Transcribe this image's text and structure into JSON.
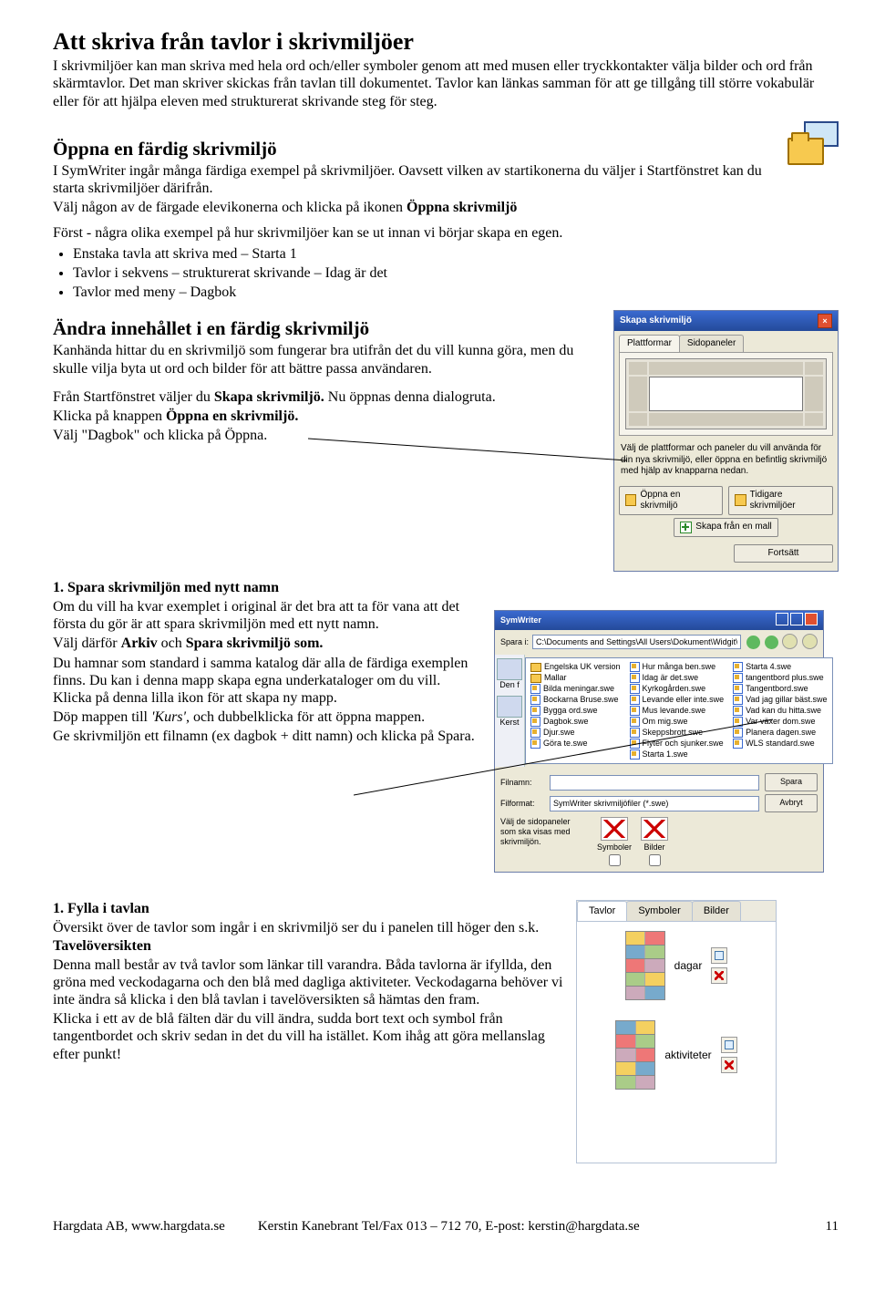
{
  "h1": "Att skriva från tavlor i skrivmiljöer",
  "intro": "I skrivmiljöer kan man skriva med hela ord och/eller symboler genom att med musen eller tryckkontakter välja bilder och ord från skärmtavlor. Det man skriver skickas från tavlan till dokumentet. Tavlor kan länkas samman för att ge tillgång till större vokabulär eller för att hjälpa eleven med strukturerat skrivande steg för steg.",
  "h2_open": "Öppna en färdig skrivmiljö",
  "open_p1": "I SymWriter ingår många färdiga exempel på skrivmiljöer. Oavsett vilken av startikonerna du väljer i Startfönstret kan du starta skrivmiljöer därifrån.",
  "open_p2a": "Välj någon av de färgade elevikonerna och klicka på ikonen ",
  "open_p2b": "Öppna skrivmiljö",
  "open_p3": "Först -  några olika exempel på hur skrivmiljöer kan se ut innan vi börjar skapa en egen.",
  "bullets": [
    "Enstaka tavla att skriva med – Starta 1",
    "Tavlor i sekvens – strukturerat skrivande – Idag är det",
    "Tavlor med meny – Dagbok"
  ],
  "h2_edit": "Ändra innehållet i en färdig skrivmiljö",
  "edit_p1": "Kanhända hittar du en skrivmiljö som fungerar bra utifrån det du vill kunna göra, men du skulle vilja byta ut ord och bilder för att bättre passa användaren.",
  "edit_p2a": "Från Startfönstret väljer du ",
  "edit_p2b": "Skapa skrivmiljö.",
  "edit_p2c": " Nu öppnas denna dialogruta.",
  "edit_p3a": "Klicka på knappen ",
  "edit_p3b": "Öppna en skrivmiljö.",
  "edit_p4": "Välj \"Dagbok\" och klicka på Öppna.",
  "h3_save": "1. Spara skrivmiljön med nytt namn",
  "save_p1": "Om du vill ha kvar exemplet i original är det bra att ta för vana att det första du gör är att spara skrivmiljön med ett nytt namn.",
  "save_p2a": "Välj därför ",
  "save_p2b": "Arkiv",
  "save_p2c": " och ",
  "save_p2d": "Spara skrivmiljö som.",
  "save_p3": "Du hamnar som standard i samma katalog där alla de färdiga exemplen finns. Du kan i denna mapp skapa egna underkataloger om du vill.  Klicka på denna lilla ikon för att skapa ny mapp.",
  "save_p4a": "Döp mappen till ",
  "save_p4b": "'Kurs'",
  "save_p4c": ", och dubbelklicka för att öppna mappen.",
  "save_p5": "Ge skrivmiljön ett filnamn (ex dagbok + ditt namn) och klicka på Spara.",
  "h3_fill": "1. Fylla i tavlan",
  "fill_p1a": "Översikt över de tavlor som ingår i en skrivmiljö ser du i panelen till höger den s.k. ",
  "fill_p1b": "Tavelöversikten",
  "fill_p2": "Denna mall består av två tavlor som länkar till varandra. Båda tavlorna är ifyllda, den gröna med veckodagarna och den blå med dagliga aktiviteter. Veckodagarna behöver vi inte ändra så klicka i den blå tavlan i tavelöversikten så hämtas den fram.",
  "fill_p3": "Klicka i ett av de blå fälten där du vill ändra, sudda bort text och symbol från tangentbordet och skriv sedan in det du vill ha istället. Kom ihåg att göra mellanslag efter punkt!",
  "dialog": {
    "title": "Skapa skrivmiljö",
    "tab1": "Plattformar",
    "tab2": "Sidopaneler",
    "desc": "Välj de plattformar och paneler du vill använda för din nya skrivmiljö, eller öppna en befintlig skrivmiljö med hjälp av knapparna nedan.",
    "btn_open": "Öppna en skrivmiljö",
    "btn_recent": "Tidigare skrivmiljöer",
    "btn_template": "Skapa från en mall",
    "btn_continue": "Fortsätt"
  },
  "savedlg": {
    "title": "SymWriter",
    "label_savein": "Spara i:",
    "path": "C:\\Documents and Settings\\All Users\\Dokument\\Widgit\\SymWriter\\Skrivmiljöer",
    "place1": "Den f",
    "place2": "Kerst",
    "col1": [
      "Engelska UK version",
      "Mallar",
      "Bilda meningar.swe",
      "Bockarna Bruse.swe",
      "Bygga ord.swe",
      "Dagbok.swe",
      "Djur.swe",
      "Göra te.swe"
    ],
    "col2": [
      "Hur många ben.swe",
      "Idag är det.swe",
      "Kyrkogården.swe",
      "Levande eller inte.swe",
      "Mus levande.swe",
      "Om mig.swe",
      "Skeppsbrott.swe",
      "Flyter och sjunker.swe",
      "Starta 1.swe"
    ],
    "col3": [
      "Starta 4.swe",
      "tangentbord plus.swe",
      "Tangentbord.swe",
      "Vad jag gillar bäst.swe",
      "Vad kan du hitta.swe",
      "Var växer dom.swe",
      "Planera dagen.swe",
      "WLS standard.swe"
    ],
    "label_filename": "Filnamn:",
    "filename": "",
    "label_format": "Filformat:",
    "format": "SymWriter skrivmiljöfiler (*.swe)",
    "btn_save": "Spara",
    "btn_cancel": "Avbryt",
    "opt_text": "Välj de sidopaneler som ska visas med skrivmiljön.",
    "opt1": "Symboler",
    "opt2": "Bilder"
  },
  "tavpanel": {
    "tab1": "Tavlor",
    "tab2": "Symboler",
    "tab3": "Bilder",
    "label1": "dagar",
    "label2": "aktiviteter"
  },
  "footer": {
    "left": "Hargdata AB, www.hargdata.se",
    "mid": "Kerstin Kanebrant  Tel/Fax 013 – 712 70, E-post: kerstin@hargdata.se",
    "page": "11"
  }
}
